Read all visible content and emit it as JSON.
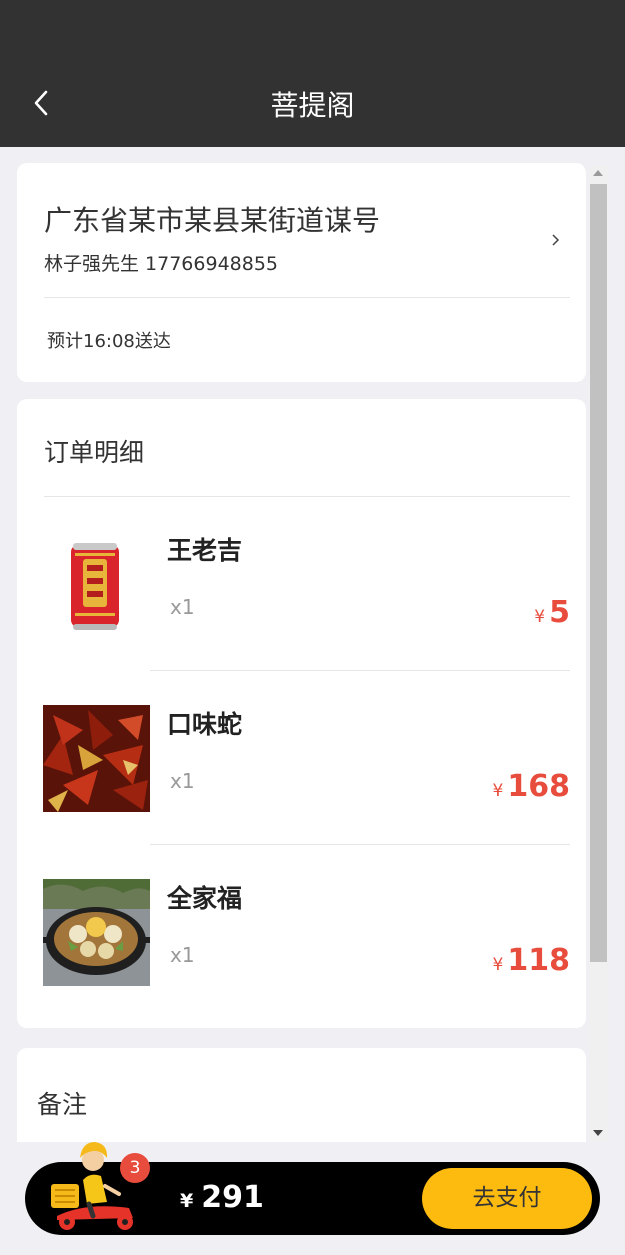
{
  "header": {
    "title": "菩提阁"
  },
  "address": {
    "main": "广东省某市某县某街道谋号",
    "contact": "林子强先生  17766948855",
    "eta": "预计16:08送达"
  },
  "order": {
    "title": "订单明细",
    "currency": "¥",
    "items": [
      {
        "name": "王老吉",
        "qty": "x1",
        "price": "5"
      },
      {
        "name": "口味蛇",
        "qty": "x1",
        "price": "168"
      },
      {
        "name": "全家福",
        "qty": "x1",
        "price": "118"
      }
    ]
  },
  "note": {
    "title": "备注"
  },
  "cart": {
    "badge": "3",
    "currency": "¥",
    "total": "291",
    "pay_label": "去支付"
  },
  "colors": {
    "header_bg": "#323232",
    "price": "#e74c3c",
    "pay_button": "#fdbb10",
    "badge": "#e84c3d"
  }
}
